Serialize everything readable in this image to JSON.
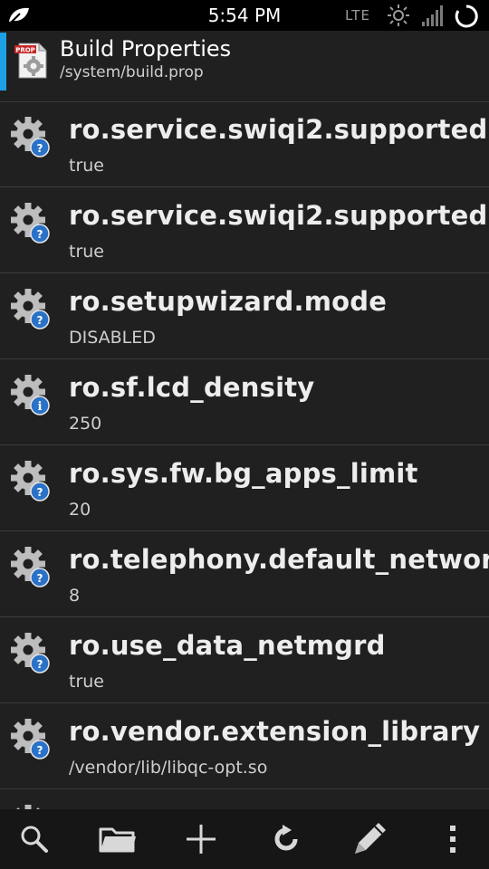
{
  "status_bar": {
    "time": "5:54 PM",
    "network": "LTE",
    "icons": [
      "leaf-icon",
      "brightness-icon",
      "signal-icon",
      "sync-icon"
    ]
  },
  "header": {
    "title": "Build Properties",
    "subtitle": "/system/build.prop",
    "icon_label": "PROP",
    "accent_color": "#1ea0e6"
  },
  "properties": [
    {
      "name": "ro.service.swiqi2.supported",
      "value": "true",
      "icon": "gear-question-icon"
    },
    {
      "name": "ro.service.swiqi2.supported",
      "value": "true",
      "icon": "gear-question-icon"
    },
    {
      "name": "ro.setupwizard.mode",
      "value": "DISABLED",
      "icon": "gear-question-icon"
    },
    {
      "name": "ro.sf.lcd_density",
      "value": "250",
      "icon": "gear-info-icon"
    },
    {
      "name": "ro.sys.fw.bg_apps_limit",
      "value": "20",
      "icon": "gear-question-icon"
    },
    {
      "name": "ro.telephony.default_network",
      "value": "8",
      "icon": "gear-question-icon"
    },
    {
      "name": "ro.use_data_netmgrd",
      "value": "true",
      "icon": "gear-question-icon"
    },
    {
      "name": "ro.vendor.extension_library",
      "value": "/vendor/lib/libqc-opt.so",
      "icon": "gear-question-icon"
    }
  ],
  "bottom_bar": {
    "buttons": [
      "search-icon",
      "folder-icon",
      "add-icon",
      "refresh-icon",
      "edit-icon",
      "overflow-menu-icon"
    ]
  }
}
